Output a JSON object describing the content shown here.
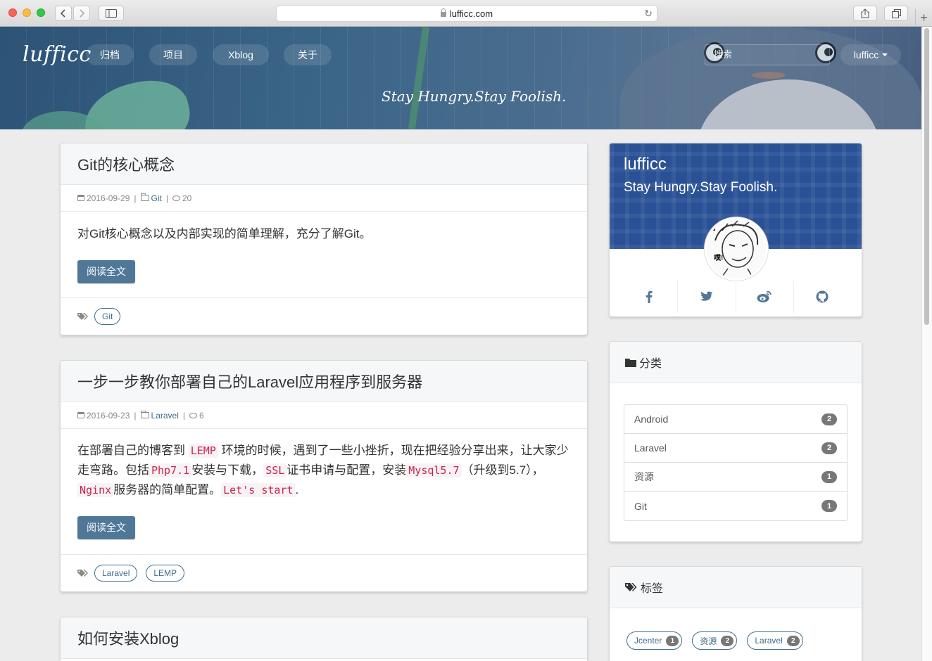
{
  "browser": {
    "url": "lufficc.com"
  },
  "header": {
    "logo": "lufficc",
    "nav": [
      {
        "label": "归档"
      },
      {
        "label": "项目"
      },
      {
        "label": "Xblog"
      },
      {
        "label": "关于"
      }
    ],
    "search_placeholder": "搜索",
    "user": "lufficc",
    "motto": "Stay Hungry.Stay Foolish."
  },
  "posts": [
    {
      "title": "Git的核心概念",
      "date": "2016-09-29",
      "category": "Git",
      "comments": "20",
      "excerpt": "对Git核心概念以及内部实现的简单理解，充分了解Git。",
      "read_more": "阅读全文",
      "tags": [
        "Git"
      ]
    },
    {
      "title": "一步一步教你部署自己的Laravel应用程序到服务器",
      "date": "2016-09-23",
      "category": "Laravel",
      "comments": "6",
      "excerpt_parts": {
        "p1": "在部署自己的博客到 ",
        "c1": "LEMP",
        "p2": " 环境的时候，遇到了一些小挫折，现在把经验分享出来，让大家少走弯路。包括",
        "c2": "Php7.1",
        "p3": "安装与下载，",
        "c3": "SSL",
        "p4": "证书申请与配置，安装",
        "c4": "Mysql5.7",
        "p5": "（升级到5.7），",
        "c5": "Nginx",
        "p6": "服务器的简单配置。",
        "c6": "Let's start",
        "p7": "."
      },
      "read_more": "阅读全文",
      "tags": [
        "Laravel",
        "LEMP"
      ]
    },
    {
      "title": "如何安装Xblog"
    }
  ],
  "sidebar": {
    "profile": {
      "name": "lufficc",
      "motto": "Stay Hungry.Stay Foolish.",
      "avatar_caption": "噗!"
    },
    "social_icons": [
      "facebook-icon",
      "twitter-icon",
      "weibo-icon",
      "github-icon"
    ],
    "categories": {
      "title": "分类",
      "items": [
        {
          "name": "Android",
          "count": "2"
        },
        {
          "name": "Laravel",
          "count": "2"
        },
        {
          "name": "资源",
          "count": "1"
        },
        {
          "name": "Git",
          "count": "1"
        }
      ]
    },
    "tags": {
      "title": "标签",
      "items": [
        {
          "name": "Jcenter",
          "count": "1"
        },
        {
          "name": "资源",
          "count": "2"
        },
        {
          "name": "Laravel",
          "count": "2"
        }
      ]
    }
  },
  "colors": {
    "accent": "#4f7797",
    "link": "#3f6e8b",
    "code": "#c7254e",
    "profile_bg": "#2a5196"
  }
}
